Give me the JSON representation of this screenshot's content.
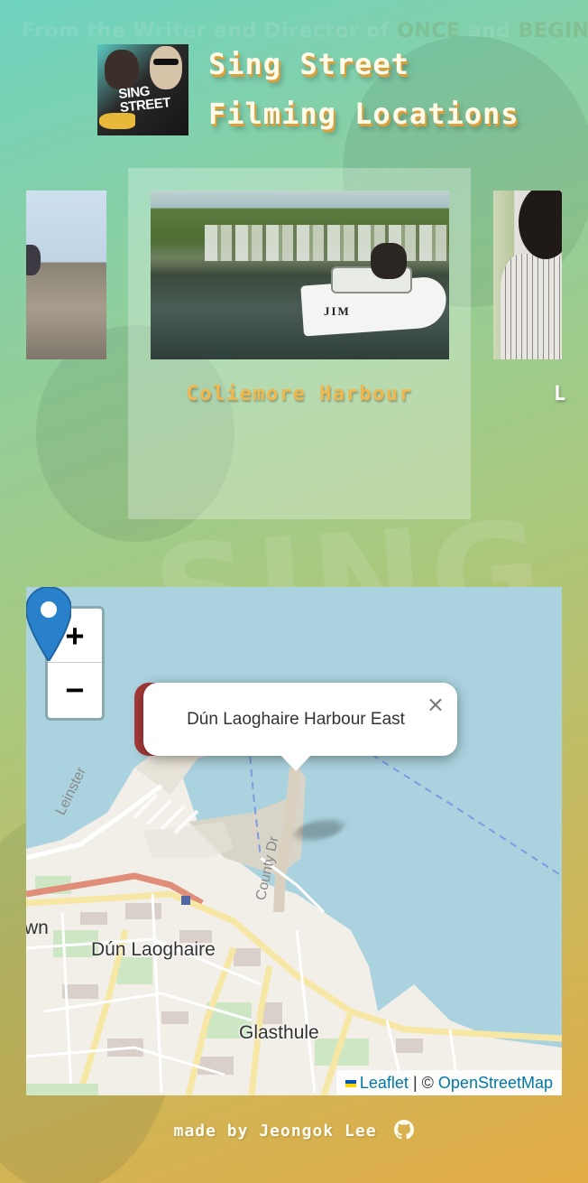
{
  "backdrop": {
    "tagline_prefix": "From the Writer and Director of",
    "tagline_film1": "ONCE",
    "tagline_and": "and",
    "tagline_film2": "BEGIN AGAIN",
    "big_word": "SING"
  },
  "header": {
    "poster_title": "SING STREET",
    "title_line1": "Sing Street",
    "title_line2": "Filming Locations"
  },
  "carousel": {
    "active_caption": "Coliemore Harbour",
    "active_boat_name": "JIM",
    "next_caption_partial": "L"
  },
  "map": {
    "zoom_in": "+",
    "zoom_out": "−",
    "popup_text": "Dún Laoghaire Harbour East",
    "popup_close": "×",
    "labels": {
      "town1": "Dún Laoghaire",
      "town2": "Glasthule",
      "road1": "Leinster",
      "road2": "County Dr",
      "left_cut": "wn"
    },
    "attribution": {
      "leaflet": "Leaflet",
      "separator": "| ©",
      "osm": "OpenStreetMap"
    }
  },
  "footer": {
    "text": "made by Jeongok Lee"
  },
  "colors": {
    "accent": "#f2b64a",
    "link": "#0078a8",
    "marker": "#2a81cb",
    "sea": "#aad3df"
  },
  "icons": [
    "github-icon",
    "close-icon",
    "map-marker-icon",
    "ukraine-flag-icon"
  ]
}
